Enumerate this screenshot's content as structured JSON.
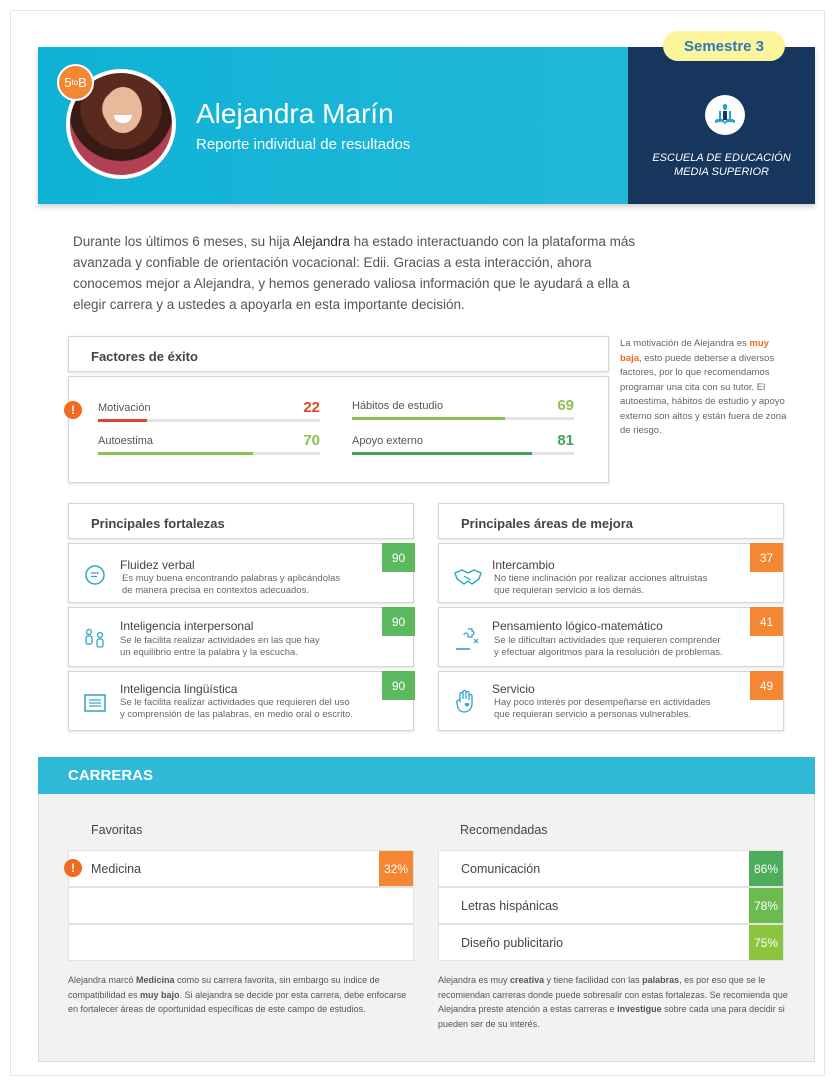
{
  "header": {
    "grade_main": "5",
    "grade_sup": "to",
    "grade_group": "B",
    "student_name": "Alejandra Marín",
    "subtitle": "Reporte individual de resultados",
    "semester": "Semestre 3",
    "school_line1": "ESCUELA DE EDUCACIÓN",
    "school_line2": "MEDIA SUPERIOR"
  },
  "intro": {
    "p1": "Durante los últimos 6 meses, su hija ",
    "name": "Alejandra",
    "p2": " ha estado interactuando con la plataforma más avanzada y confiable de orientación vocacional: Edii. Gracias a esta interacción, ahora conocemos mejor a Alejandra, y hemos generado valiosa información que le ayudará a ella a elegir carrera y a ustedes a apoyarla en esta importante decisión."
  },
  "factors": {
    "title": "Factores de éxito",
    "alert_symbol": "!",
    "items": [
      {
        "label": "Motivación",
        "value": "22",
        "level": 0.22,
        "color": "#e0452b"
      },
      {
        "label": "Hábitos de estudio",
        "value": "69",
        "level": 0.69,
        "color": "#8cc152"
      },
      {
        "label": "Autoestima",
        "value": "70",
        "level": 0.7,
        "color": "#8cc152"
      },
      {
        "label": "Apoyo externo",
        "value": "81",
        "level": 0.81,
        "color": "#3ea55a"
      }
    ]
  },
  "side_note": {
    "p1": "La motivación de Alejandra es ",
    "highlight": "muy baja",
    "p2": ", esto puede deberse a diversos factores, por lo que recomendamos programar una cita con su tutor. El autoestima, hábitos de estudio y apoyo externo son altos y están fuera de zona de riesgo."
  },
  "strengths": {
    "title": "Principales fortalezas",
    "items": [
      {
        "title": "Fluidez verbal",
        "desc1": "Es muy buena encontrando palabras y aplicándolas",
        "desc2": "de manera precisa en contextos adecuados.",
        "score": "90",
        "icon": "chat-bubble-icon"
      },
      {
        "title": "Inteligencia interpersonal",
        "desc1": "Se le facilita realizar actividades en las que hay",
        "desc2": "un equilibrio entre la palabra y la escucha.",
        "score": "90",
        "icon": "people-icon"
      },
      {
        "title": "Inteligencia lingüística",
        "desc1": "Se le facilita realizar actividades que requieren del uso",
        "desc2": "y comprensión de las palabras, en medio oral o escrito.",
        "score": "90",
        "icon": "text-lines-icon"
      }
    ]
  },
  "improvements": {
    "title": "Principales áreas de mejora",
    "items": [
      {
        "title": "Intercambio",
        "desc1": "No tiene inclinación por realizar acciones altruistas",
        "desc2": "que requieran servicio a los demás.",
        "score": "37",
        "icon": "handshake-icon"
      },
      {
        "title": "Pensamiento lógico-matemático",
        "desc1": "Se le dificultan actividades que requieren comprender",
        "desc2": "y efectuar algoritmos  para la resolución de problemas.",
        "score": "41",
        "icon": "puzzle-icon"
      },
      {
        "title": "Servicio",
        "desc1": "Hay poco interés por desempeñarse en actividades",
        "desc2": "que requieran servicio a personas vulnerables.",
        "score": "49",
        "icon": "hand-heart-icon"
      }
    ]
  },
  "careers": {
    "title": "CARRERAS",
    "favorites_title": "Favoritas",
    "recommended_title": "Recomendadas",
    "favorites": [
      {
        "label": "Medicina",
        "pct": "32%"
      },
      {
        "label": "",
        "pct": ""
      },
      {
        "label": "",
        "pct": ""
      }
    ],
    "recommended": [
      {
        "label": "Comunicación",
        "pct": "86%",
        "color": "#4cae5b"
      },
      {
        "label": "Letras hispánicas",
        "pct": "78%",
        "color": "#6dbb4f"
      },
      {
        "label": "Diseño publicitario",
        "pct": "75%",
        "color": "#8cc43e"
      }
    ],
    "fav_note": {
      "a": "Alejandra marcó ",
      "b": "Medicina",
      "c": " como su carrera favorita, sin embargo su índice de compatibilidad es ",
      "d": "muy bajo",
      "e": ". Si alejandra se decide por esta carrera, debe enfocarse en fortalecer áreas de oportunidad específicas de este campo de estudios."
    },
    "rec_note": {
      "a": "Alejandra es muy ",
      "b": "creativa",
      "c": " y tiene facilidad con las ",
      "d": "palabras",
      "e": ", es por eso que se le recomiendan carreras donde puede sobresalir con estas fortalezas. Se recomienda que Alejandra preste atención a estas carreras e ",
      "f": "investigue",
      "g": " sobre cada una para decidir si pueden ser de su interés."
    }
  },
  "colors": {
    "orange": "#f58634",
    "green": "#5cb85c",
    "cyan": "#2fb9d6",
    "navy": "#17365d"
  }
}
